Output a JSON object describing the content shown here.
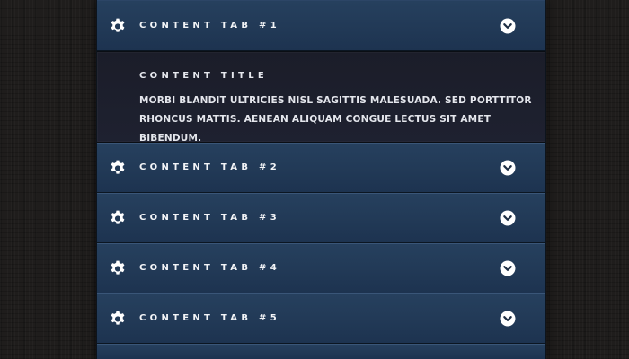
{
  "accordion": {
    "tabs": [
      {
        "label": "CONTENT TAB #1",
        "icon": "gear-icon",
        "toggle_icon": "chevron-down-icon",
        "expanded": true
      },
      {
        "label": "CONTENT TAB #2",
        "icon": "gear-icon",
        "toggle_icon": "chevron-down-icon",
        "expanded": false
      },
      {
        "label": "CONTENT TAB #3",
        "icon": "gear-icon",
        "toggle_icon": "chevron-down-icon",
        "expanded": false
      },
      {
        "label": "CONTENT TAB #4",
        "icon": "gear-icon",
        "toggle_icon": "chevron-down-icon",
        "expanded": false
      },
      {
        "label": "CONTENT TAB #5",
        "icon": "gear-icon",
        "toggle_icon": "chevron-down-icon",
        "expanded": false
      }
    ],
    "open_panel": {
      "title": "CONTENT TITLE",
      "body": "MORBI BLANDIT ULTRICIES NISL SAGITTIS MALESUADA. SED PORTTITOR RHONCUS MATTIS. AENEAN ALIQUAM CONGUE LECTUS SIT AMET BIBENDUM."
    }
  },
  "colors": {
    "background": "#1f1d1c",
    "tab": "#223a57",
    "panel": "#1d1f2c",
    "text": "#f2f4f7",
    "icon": "#ffffff"
  }
}
